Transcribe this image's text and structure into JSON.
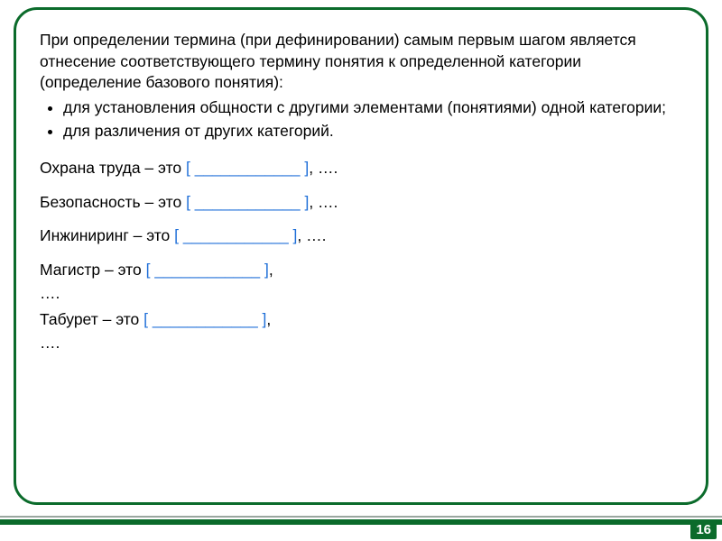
{
  "intro": "При определении термина (при дефинировании) самым первым шагом является отнесение соответствующего термину понятия к определенной категории (определение базового понятия):",
  "bullets": [
    "для установления общности с другими элементами (понятиями) одной категории;",
    "для различения от других категорий."
  ],
  "examples": [
    {
      "term": "Охрана труда",
      "sep": " – это ",
      "placeholder": "[  ____________   ]",
      "trail": ", …."
    },
    {
      "term": "Безопасность",
      "sep": " – это ",
      "placeholder": "[  ____________   ]",
      "trail": ", …."
    },
    {
      "term": "Инжиниринг",
      "sep": " – это ",
      "placeholder": "[  ____________   ]",
      "trail": ", …."
    },
    {
      "term": "Магистр",
      "sep": " – это ",
      "placeholder": "[  ____________   ]",
      "trail_split": ", ",
      "trail_line2": "…."
    },
    {
      "term": "Табурет",
      "sep": " – это ",
      "placeholder": "[  ____________   ]",
      "trail_split": ", ",
      "trail_line2": "…."
    }
  ],
  "page_number": "16",
  "colors": {
    "frame_green": "#0b6b2b",
    "accent_blue": "#1f6fd8"
  }
}
